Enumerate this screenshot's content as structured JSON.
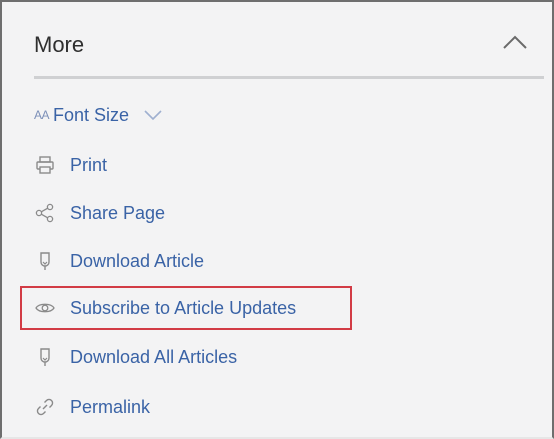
{
  "panel": {
    "title": "More",
    "collapse_icon": "chevron-up-icon"
  },
  "menu": {
    "font_size": {
      "prefix": "AA",
      "label": "Font Size",
      "chevron_icon": "chevron-down-icon"
    },
    "items": [
      {
        "label": "Print",
        "icon": "printer-icon"
      },
      {
        "label": "Share Page",
        "icon": "share-icon"
      },
      {
        "label": "Download Article",
        "icon": "download-icon"
      },
      {
        "label": "Subscribe to Article Updates",
        "icon": "eye-icon",
        "highlighted": true
      },
      {
        "label": "Download All Articles",
        "icon": "download-icon"
      },
      {
        "label": "Permalink",
        "icon": "link-icon"
      }
    ]
  },
  "colors": {
    "link": "#3a63a6",
    "icon": "#8a8a8a",
    "panel_bg": "#f3f3f4",
    "highlight_border": "#d23b45"
  }
}
